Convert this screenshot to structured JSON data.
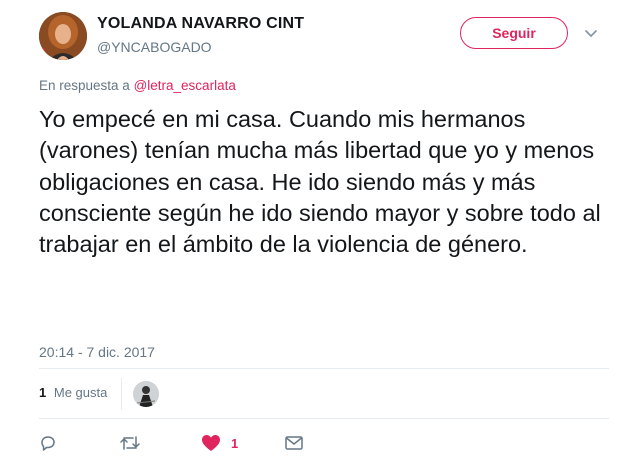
{
  "author": {
    "display_name": "YOLANDA NAVARRO CINT",
    "handle": "@YNCABOGADO"
  },
  "follow_button": {
    "label": "Seguir"
  },
  "reply_context": {
    "prefix": "En respuesta a",
    "mention": "@letra_escarlata"
  },
  "tweet": {
    "text": "Yo empecé en mi casa. Cuando mis hermanos (varones) tenían mucha más libertad que yo y menos obligaciones en casa. He ido siendo más y más consciente según he ido siendo mayor y sobre todo al trabajar en el ámbito de la violencia de género.",
    "timestamp": "20:14 - 7 dic. 2017"
  },
  "stats": {
    "likes_count": "1",
    "likes_label": "Me gusta"
  },
  "actions": {
    "reply_icon": "reply-icon",
    "retweet_icon": "retweet-icon",
    "like_icon": "heart-icon",
    "like_count": "1",
    "dm_icon": "envelope-icon"
  },
  "colors": {
    "accent": "#e0245e",
    "secondary_text": "#657786",
    "primary_text": "#14171a",
    "divider": "#e6ecf0"
  }
}
